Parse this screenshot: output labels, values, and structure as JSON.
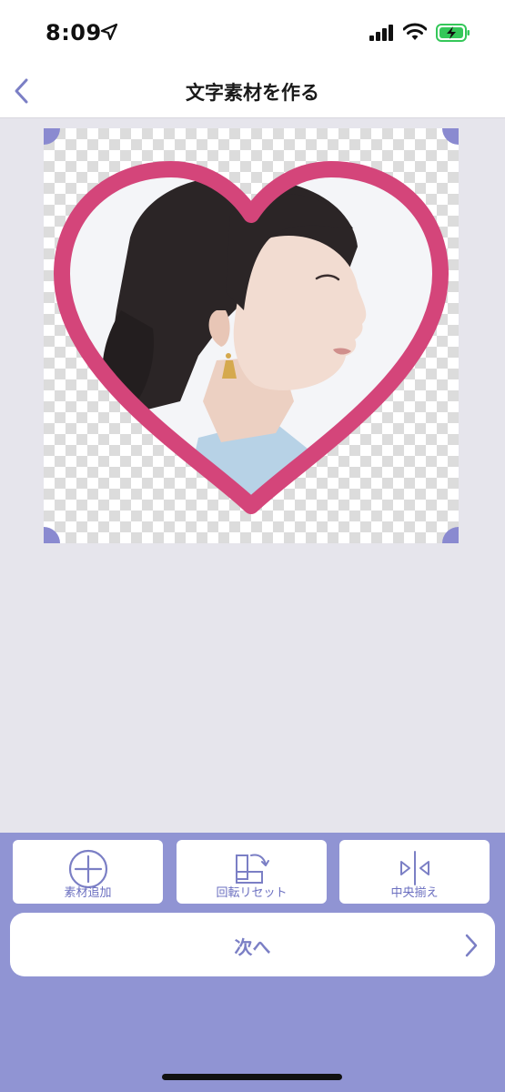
{
  "status_bar": {
    "time": "8:09"
  },
  "nav": {
    "title": "文字素材を作る"
  },
  "toolbar": {
    "add_material_label": "素材追加",
    "rotate_reset_label": "回転リセット",
    "center_align_label": "中央揃え"
  },
  "next_button": {
    "label": "次へ"
  },
  "colors": {
    "accent": "#8a8ad0",
    "panel": "#9094d3",
    "heart_frame": "#d4457a",
    "canvas_bg": "#e6e5ec"
  },
  "icons": {
    "back": "chevron-left-icon",
    "add": "plus-circle-icon",
    "rotate": "rotate-reset-icon",
    "center": "center-align-icon",
    "next": "chevron-right-icon"
  }
}
